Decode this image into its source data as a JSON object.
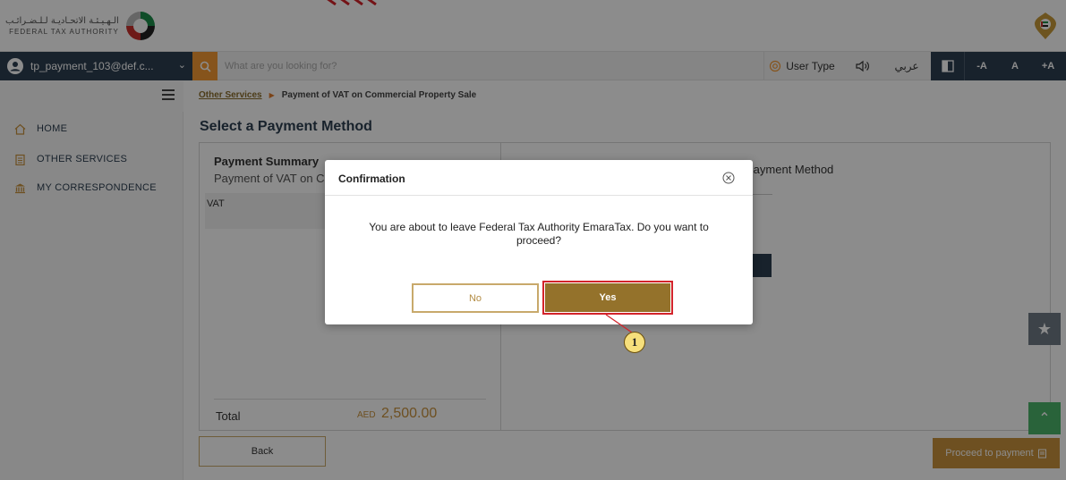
{
  "header": {
    "logo_arabic": "الـهـيـئـة الاتحـاديـة لـلـضـرائـب",
    "logo_english": "FEDERAL TAX AUTHORITY"
  },
  "topnav": {
    "username": "tp_payment_103@def.c...",
    "search_placeholder": "What are you looking for?",
    "user_type_label": "User Type",
    "arabic_label": "عربي",
    "font_decrease": "-A",
    "font_normal": "A",
    "font_increase": "+A"
  },
  "breadcrumb": {
    "link": "Other Services",
    "current": "Payment of VAT on Commercial Property Sale"
  },
  "sidebar": {
    "items": [
      {
        "label": "HOME"
      },
      {
        "label": "OTHER SERVICES"
      },
      {
        "label": "MY CORRESPONDENCE"
      }
    ]
  },
  "main": {
    "page_title": "Select a Payment Method",
    "payment_summary_title": "Payment Summary",
    "payment_summary_sub": "Payment of VAT on C",
    "vat_label": "VAT",
    "total_label": "Total",
    "total_currency": "AED",
    "total_amount": "2,500.00",
    "right_title": "Payment Method",
    "back_label": "Back",
    "proceed_label": "Proceed to payment"
  },
  "modal": {
    "title": "Confirmation",
    "message": "You are about to leave Federal Tax Authority EmaraTax. Do you want to proceed?",
    "no_label": "No",
    "yes_label": "Yes"
  },
  "annotation": {
    "badge": "1"
  },
  "colors": {
    "navy": "#2c3e50",
    "gold": "#94722b",
    "gold_light": "#c8923d",
    "search_orange": "#f49a33",
    "highlight_red": "#d3242b",
    "float_green": "#4cb46b"
  }
}
